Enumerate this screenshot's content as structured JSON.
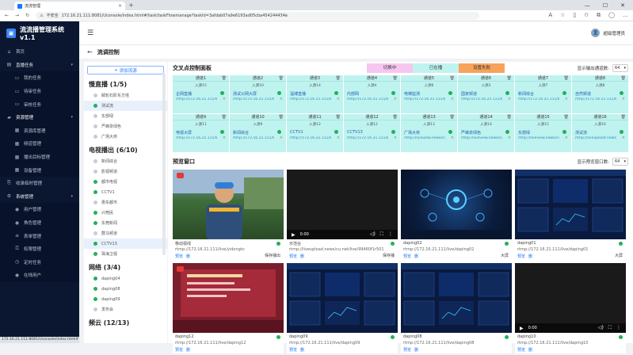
{
  "browser": {
    "tab_title": "流流管理",
    "address_security": "不安全",
    "address_url": "172.16.21.111:8081/Uconsole/index.html#/task/taskFlowmanage?taskId=3afdab07a9e6193ad05cba454244434e",
    "status_url": "172.16.21.111:8081/Uconsole/index.html#"
  },
  "sidebar": {
    "app_title_line1": "流流播管理系统",
    "app_title_line2": "v1.1",
    "items": [
      {
        "label": "首页",
        "icon": "home-icon",
        "kind": "top"
      },
      {
        "label": "直播任务",
        "icon": "task-icon",
        "kind": "group"
      },
      {
        "label": "我的任务",
        "icon": "doc-icon",
        "kind": "sub"
      },
      {
        "label": "待审任务",
        "icon": "doc-icon",
        "kind": "sub"
      },
      {
        "label": "审核任务",
        "icon": "doc-icon",
        "kind": "sub"
      },
      {
        "label": "资源管理",
        "icon": "folder-icon",
        "kind": "group",
        "active": true
      },
      {
        "label": "资源库管理",
        "icon": "grid-icon",
        "kind": "sub"
      },
      {
        "label": "频道管理",
        "icon": "grid-icon",
        "kind": "sub"
      },
      {
        "label": "播出目标管理",
        "icon": "grid-icon",
        "kind": "sub"
      },
      {
        "label": "设备管理",
        "icon": "grid-icon",
        "kind": "sub"
      },
      {
        "label": "收录临时管理",
        "icon": "clip-icon",
        "kind": "top"
      },
      {
        "label": "系统管理",
        "icon": "gear-icon",
        "kind": "group"
      },
      {
        "label": "用户管理",
        "icon": "user-icon",
        "kind": "sub"
      },
      {
        "label": "角色管理",
        "icon": "user-icon",
        "kind": "sub"
      },
      {
        "label": "表单管理",
        "icon": "list-icon",
        "kind": "sub"
      },
      {
        "label": "权限管理",
        "icon": "lock-icon",
        "kind": "sub"
      },
      {
        "label": "定时任务",
        "icon": "clock-icon",
        "kind": "sub"
      },
      {
        "label": "在线用户",
        "icon": "user-icon",
        "kind": "sub"
      }
    ]
  },
  "header": {
    "username": "超级管理员"
  },
  "page": {
    "title": "流调控制"
  },
  "left_panel": {
    "add_button": "添加流源",
    "groups": [
      {
        "title": "慢直播 (1/5)",
        "items": [
          {
            "label": "邮轮石阶东方塔",
            "online": false
          },
          {
            "label": "测试流",
            "online": true,
            "highlight": true
          },
          {
            "label": "东部绿",
            "online": false
          },
          {
            "label": "严峰泉绿色",
            "online": false
          },
          {
            "label": "广场大桥",
            "online": false
          }
        ]
      },
      {
        "title": "电视播出 (6/10)",
        "items": [
          {
            "label": "新闻综合",
            "online": false
          },
          {
            "label": "影视频道",
            "online": false
          },
          {
            "label": "都市电视",
            "online": true
          },
          {
            "label": "CCTV1",
            "online": true
          },
          {
            "label": "惠东都市",
            "online": false
          },
          {
            "label": "兴莞民",
            "online": true
          },
          {
            "label": "东莞新闻",
            "online": true
          },
          {
            "label": "群马频道",
            "online": false
          },
          {
            "label": "CCTV13",
            "online": true,
            "highlight": true
          },
          {
            "label": "珠海卫视",
            "online": true
          }
        ]
      },
      {
        "title": "网络 (3/4)",
        "items": [
          {
            "label": "daping04",
            "online": true
          },
          {
            "label": "daping08",
            "online": true
          },
          {
            "label": "daping09",
            "online": true
          },
          {
            "label": "发布会",
            "online": false
          }
        ]
      },
      {
        "title": "频云 (12/13)",
        "items": []
      }
    ]
  },
  "control": {
    "title": "交叉点控制面板",
    "legend": [
      {
        "label": "切换中",
        "color": "#f7c6f0"
      },
      {
        "label": "已在播",
        "color": "#bff3ef"
      },
      {
        "label": "设置失败",
        "color": "#f7a35c"
      }
    ],
    "count_label": "显示输出通道数:",
    "count_value": "64",
    "cells": [
      {
        "ch": "通道1",
        "in": "入源15",
        "name": "企网直播",
        "url": "rtmp://172.16.21.111/live/x1"
      },
      {
        "ch": "通道2",
        "in": "入源10",
        "name": "测试公网大屏",
        "url": "rtmp://172.16.21.111/live/x2"
      },
      {
        "ch": "通道3",
        "in": "入源14",
        "name": "淄博直播",
        "url": "rtmp://172.16.21.111/live/x3"
      },
      {
        "ch": "通道4",
        "in": "入源4",
        "name": "内部网",
        "url": "rtmp://172.16.21.111/live/x4"
      },
      {
        "ch": "通道5",
        "in": "入源6",
        "name": "电梯监测",
        "url": "rtmp://172.16.21.111/live/x5"
      },
      {
        "ch": "通道6",
        "in": "入源3",
        "name": "国家频道",
        "url": "rtmp://172.16.21.111/live/x6"
      },
      {
        "ch": "通道7",
        "in": "入源7",
        "name": "新闻综合",
        "url": "rtmp://172.16.21.111/live/x7"
      },
      {
        "ch": "通道8",
        "in": "入源8",
        "name": "自然频道",
        "url": "rtmp://172.16.21.111/live/x8"
      },
      {
        "ch": "通道9",
        "in": "入源11",
        "name": "电视大屏",
        "url": "rtmp://172.16.21.111/live/x9"
      },
      {
        "ch": "通道10",
        "in": "入源9",
        "name": "新闻综合",
        "url": "rtmp://172.16.21.111/live/x10"
      },
      {
        "ch": "通道11",
        "in": "入源12",
        "name": "CCTV1",
        "url": "rtmp://172.16.21.111/live/x11"
      },
      {
        "ch": "通道12",
        "in": "入源12",
        "name": "CCTV13",
        "url": "rtmp://172.16.21.111/live/x12"
      },
      {
        "ch": "通道13",
        "in": "入源13",
        "name": "广场大桥",
        "url": "rtmp://liveview.news/x13"
      },
      {
        "ch": "通道14",
        "in": "入源14",
        "name": "严峰泉绿色",
        "url": "rtmp://liveview.news/x14"
      },
      {
        "ch": "通道15",
        "in": "入源15",
        "name": "东部绿",
        "url": "rtmp://liveview.news/x15"
      },
      {
        "ch": "通道16",
        "in": "入源16",
        "name": "测试流",
        "url": "rtmp://liveupload.news/x16"
      }
    ]
  },
  "preview": {
    "title": "预览窗口",
    "count_label": "显示预览窗口数:",
    "count_value": "64",
    "items": [
      {
        "name": "移动视线",
        "url": "rtmp://172.16.21.111/live/yidongtv",
        "actions": [
          "预览",
          "删"
        ],
        "right": "保存播出",
        "scene": "person"
      },
      {
        "name": "示范台",
        "url": "rtmp://liveupload.news/cu.net/live/99460f1r501",
        "actions": [
          "预览",
          "删"
        ],
        "right": "保存播",
        "scene": "dark",
        "time": "0:00"
      },
      {
        "name": "daping02",
        "url": "rtmp://172.16.21.111/live/daping02",
        "actions": [
          "预览",
          "删"
        ],
        "right": "大屏",
        "scene": "tech"
      },
      {
        "name": "daping01",
        "url": "rtmp://172.16.21.111/live/daping01",
        "actions": [
          "预览",
          "删"
        ],
        "right": "大屏",
        "scene": "dash"
      },
      {
        "name": "daping12",
        "url": "rtmp://172.16.21.111/live/daping12",
        "actions": [
          "预览",
          "删"
        ],
        "right": "",
        "scene": "slide"
      },
      {
        "name": "daping09",
        "url": "rtmp://172.16.21.111/live/daping09",
        "actions": [
          "预览",
          "删"
        ],
        "right": "",
        "scene": "dash"
      },
      {
        "name": "daping08",
        "url": "rtmp://172.16.21.111/live/daping08",
        "actions": [
          "预览",
          "删"
        ],
        "right": "",
        "scene": "dash"
      },
      {
        "name": "daping10",
        "url": "rtmp://172.16.21.111/live/daping10",
        "actions": [
          "预览",
          "删"
        ],
        "right": "",
        "scene": "dark",
        "time": "0:00"
      }
    ]
  }
}
